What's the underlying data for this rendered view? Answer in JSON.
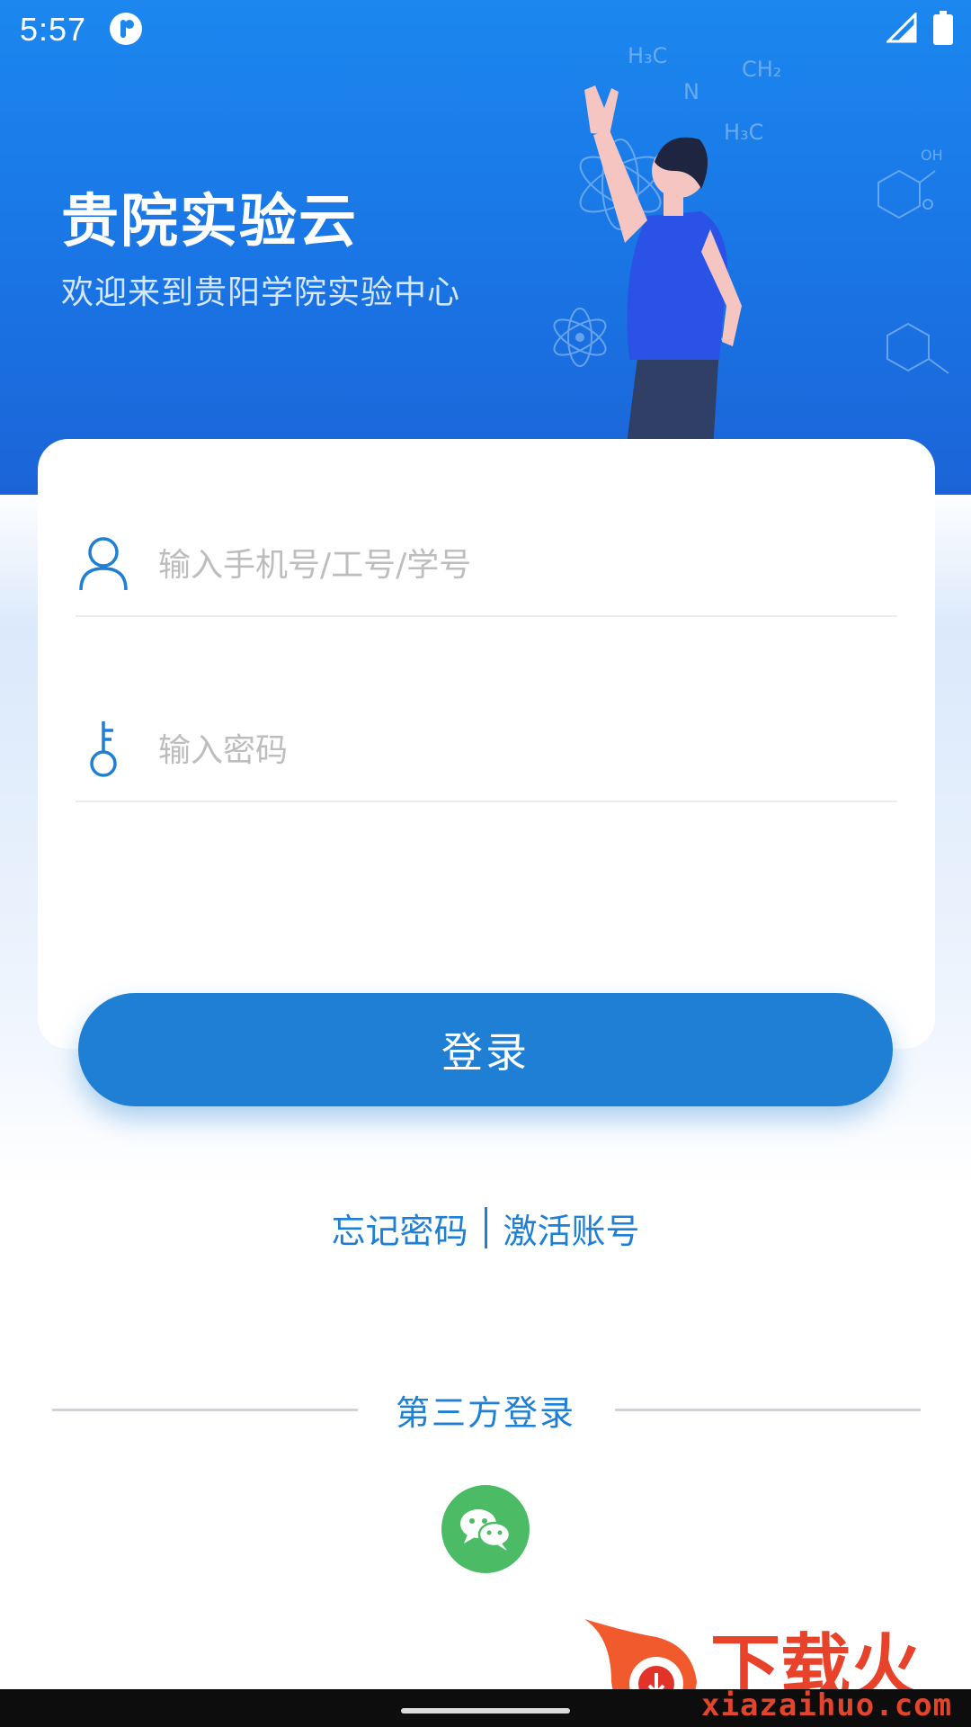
{
  "status_bar": {
    "time": "5:57",
    "app_icon": "app-notification-icon",
    "signal_icon": "cell-signal-icon",
    "battery_icon": "battery-icon"
  },
  "hero": {
    "title": "贵院实验云",
    "subtitle": "欢迎来到贵阳学院实验中心",
    "illustration": "scientist-chemistry-illustration"
  },
  "login_form": {
    "account_icon": "user-icon",
    "account_placeholder": "输入手机号/工号/学号",
    "account_value": "",
    "password_icon": "key-icon",
    "password_placeholder": "输入密码",
    "password_value": "",
    "login_label": "登录"
  },
  "links": {
    "forgot_password": "忘记密码",
    "activate_account": "激活账号"
  },
  "third_party": {
    "label": "第三方登录",
    "wechat_icon": "wechat-icon"
  },
  "watermark": {
    "brand": "下载火",
    "url": "xiazaihuo.com"
  },
  "colors": {
    "hero_blue": "#1a78e6",
    "accent_blue": "#1e7fd4",
    "wechat_green": "#4cbb66"
  }
}
